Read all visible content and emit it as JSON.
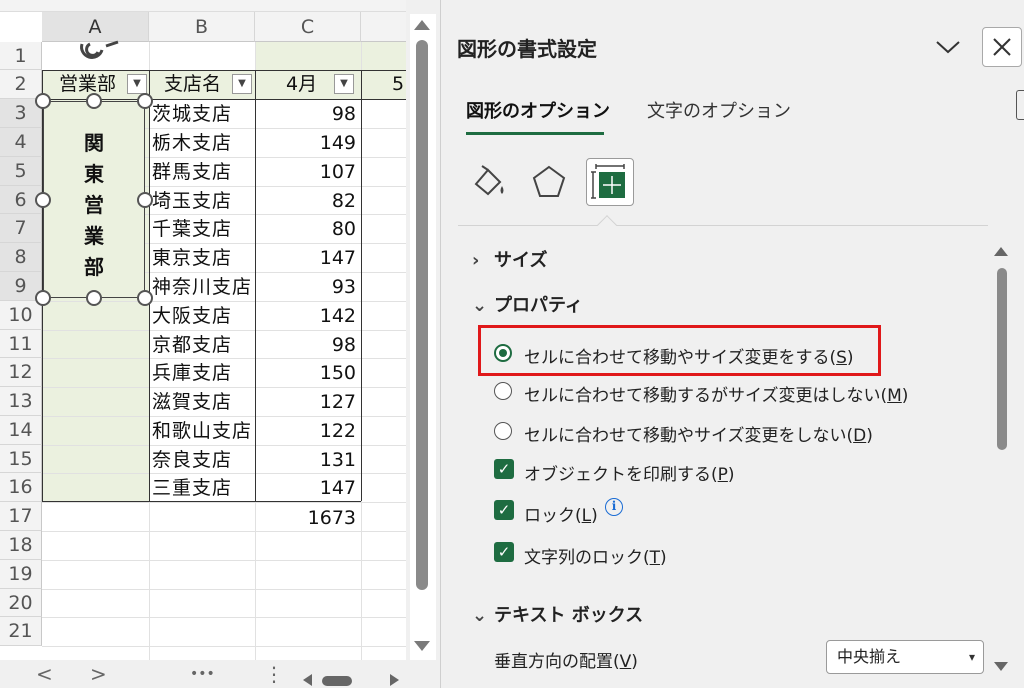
{
  "spreadsheet": {
    "columns": [
      "A",
      "B",
      "C"
    ],
    "rows": [
      "1",
      "2",
      "3",
      "4",
      "5",
      "6",
      "7",
      "8",
      "9",
      "10",
      "11",
      "12",
      "13",
      "14",
      "15",
      "16",
      "17",
      "18",
      "19",
      "20",
      "21"
    ],
    "headers": {
      "col_a": "営業部",
      "col_b": "支店名",
      "col_c": "4月",
      "col_d": "5"
    },
    "branches": [
      "茨城支店",
      "栃木支店",
      "群馬支店",
      "埼玉支店",
      "千葉支店",
      "東京支店",
      "神奈川支店",
      "大阪支店",
      "京都支店",
      "兵庫支店",
      "滋賀支店",
      "和歌山支店",
      "奈良支店",
      "三重支店"
    ],
    "april_values": [
      "98",
      "149",
      "107",
      "82",
      "80",
      "147",
      "93",
      "142",
      "98",
      "150",
      "127",
      "122",
      "131",
      "147"
    ],
    "total": "1673",
    "shape_text": [
      "関",
      "東",
      "営",
      "業",
      "部"
    ],
    "filter_icon": "filter-dropdown-icon",
    "bottom_nav": {
      "prev": "<",
      "next": ">",
      "more": "•••",
      "menu": "⋮"
    }
  },
  "panel": {
    "title": "図形の書式設定",
    "tabs": [
      {
        "label": "図形のオプション",
        "active": true
      },
      {
        "label": "文字のオプション",
        "active": false
      }
    ],
    "icons": [
      "fill-line-icon",
      "effects-pentagon-icon",
      "size-properties-icon"
    ],
    "sections": {
      "size": "サイズ",
      "properties": "プロパティ",
      "textbox": "テキスト ボックス"
    },
    "radio_options": [
      {
        "text": "セルに合わせて移動やサイズ変更をする(",
        "key": "S",
        "selected": true
      },
      {
        "text": "セルに合わせて移動するがサイズ変更はしない(",
        "key": "M",
        "selected": false
      },
      {
        "text": "セルに合わせて移動やサイズ変更をしない(",
        "key": "D",
        "selected": false
      }
    ],
    "checkbox_options": [
      {
        "text": "オブジェクトを印刷する(",
        "key": "P",
        "checked": true
      },
      {
        "text": "ロック(",
        "key": "L",
        "checked": true
      },
      {
        "text": "文字列のロック(",
        "key": "T",
        "checked": true
      }
    ],
    "vertical_align": {
      "text": "垂直方向の配置(",
      "key": "V",
      "value": "中央揃え"
    },
    "accent_color": "#1e6c41",
    "highlight_color": "#e0181a"
  }
}
